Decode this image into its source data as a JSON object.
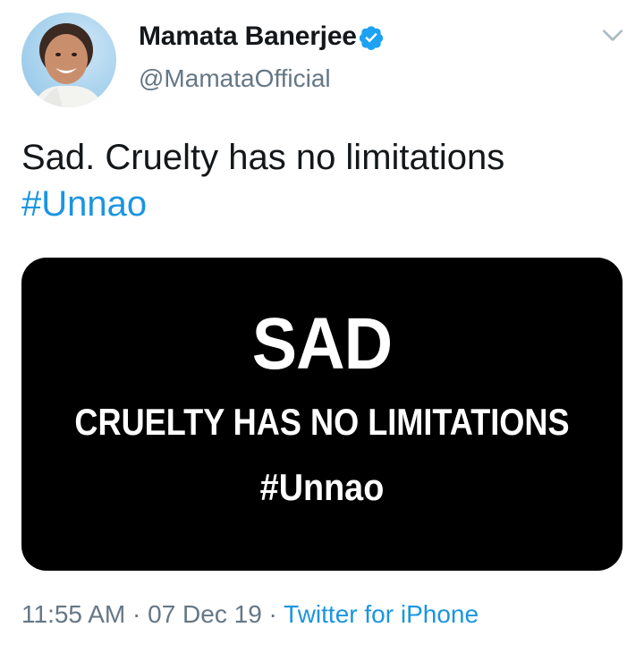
{
  "author": {
    "name": "Mamata Banerjee",
    "handle": "@MamataOfficial",
    "verified": true
  },
  "icons": {
    "verified": "verified-badge-icon",
    "menu": "chevron-down-icon"
  },
  "tweet": {
    "text": "Sad. Cruelty has no limitations",
    "hashtag": "#Unnao"
  },
  "media": {
    "headline": "SAD",
    "subline": "CRUELTY HAS NO LIMITATIONS",
    "tag": "#Unnao",
    "background": "#000000",
    "text_color": "#ffffff"
  },
  "meta": {
    "time": "11:55 AM",
    "separator": " · ",
    "date": "07 Dec 19",
    "source": "Twitter for iPhone"
  },
  "colors": {
    "link": "#1b95e0",
    "secondary_text": "#657786",
    "primary_text": "#14171a"
  }
}
